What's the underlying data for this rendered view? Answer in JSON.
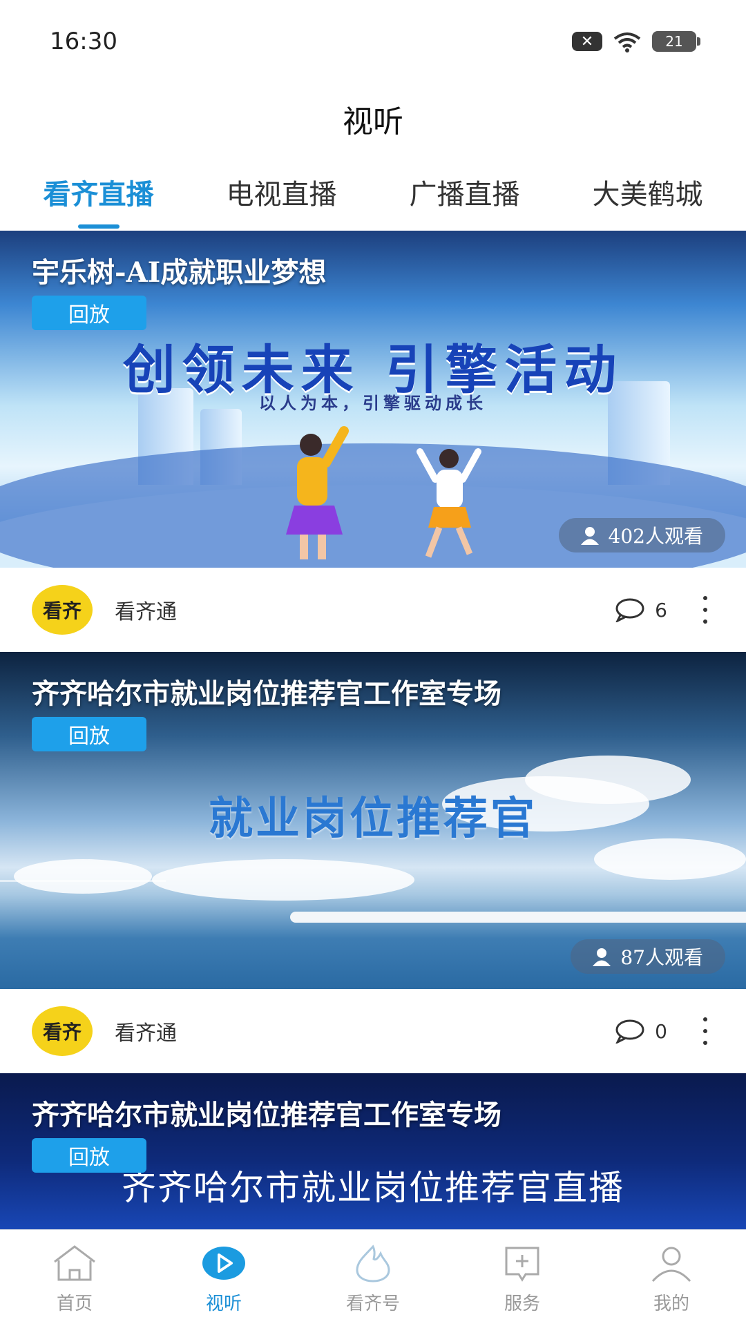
{
  "status_bar": {
    "time": "16:30",
    "battery": "21"
  },
  "page_title": "视听",
  "tabs": [
    {
      "label": "看齐直播",
      "active": true
    },
    {
      "label": "电视直播",
      "active": false
    },
    {
      "label": "广播直播",
      "active": false
    },
    {
      "label": "大美鹤城",
      "active": false
    }
  ],
  "cards": [
    {
      "title": "宇乐树-AI成就职业梦想",
      "badge": "回放",
      "viewers": "402人观看",
      "art_headline": "创领未来 引擎活动",
      "art_sub": "以人为本，引擎驱动成长",
      "publisher": "看齐通",
      "avatar_text": "看齐",
      "comment_count": "6"
    },
    {
      "title": "齐齐哈尔市就业岗位推荐官工作室专场",
      "badge": "回放",
      "viewers": "87人观看",
      "art_headline": "就业岗位推荐官",
      "publisher": "看齐通",
      "avatar_text": "看齐",
      "comment_count": "0"
    },
    {
      "title": "齐齐哈尔市就业岗位推荐官工作室专场",
      "badge": "回放",
      "art_headline": "齐齐哈尔市就业岗位推荐官直播"
    }
  ],
  "bottom_nav": [
    {
      "label": "首页",
      "icon": "home-icon",
      "active": false
    },
    {
      "label": "视听",
      "icon": "play-icon",
      "active": true
    },
    {
      "label": "看齐号",
      "icon": "flame-icon",
      "active": false
    },
    {
      "label": "服务",
      "icon": "service-icon",
      "active": false
    },
    {
      "label": "我的",
      "icon": "user-icon",
      "active": false
    }
  ],
  "colors": {
    "accent": "#1b8fd6",
    "badge": "#1ea0ea",
    "avatar": "#f5d21a"
  }
}
